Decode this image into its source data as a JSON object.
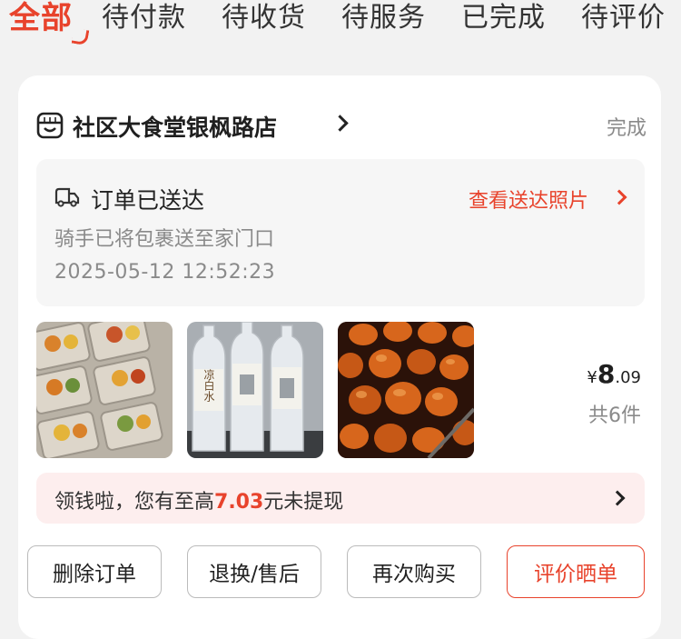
{
  "tabs": [
    {
      "label": "全部"
    },
    {
      "label": "待付款"
    },
    {
      "label": "待收货"
    },
    {
      "label": "待服务"
    },
    {
      "label": "已完成"
    },
    {
      "label": "待评价"
    }
  ],
  "order": {
    "shop_name": "社区大食堂银枫路店",
    "status": "完成",
    "delivery": {
      "title": "订单已送达",
      "link": "查看送达照片",
      "subtitle": "骑手已将包裹送至家门口",
      "timestamp": "2025-05-12 12:52:23"
    },
    "products": [
      {
        "name": "food-trays-thumbnail"
      },
      {
        "name": "water-bottles-thumbnail",
        "label": "凉白水"
      },
      {
        "name": "braised-eggs-thumbnail"
      }
    ],
    "price": {
      "currency": "¥",
      "integer": "8",
      "decimal": ".09"
    },
    "item_count": "共6件",
    "promo": {
      "prefix": "领钱啦，您有至高",
      "amount": "7.03",
      "suffix": "元未提现"
    },
    "actions": {
      "delete": "删除订单",
      "return": "退换/售后",
      "rebuy": "再次购买",
      "review": "评价晒单"
    }
  },
  "colors": {
    "accent": "#e8432c",
    "background": "#f2f2f2",
    "muted": "#8a8a8a"
  },
  "icons": {
    "shop": "shop-icon",
    "delivery": "truck-icon"
  }
}
